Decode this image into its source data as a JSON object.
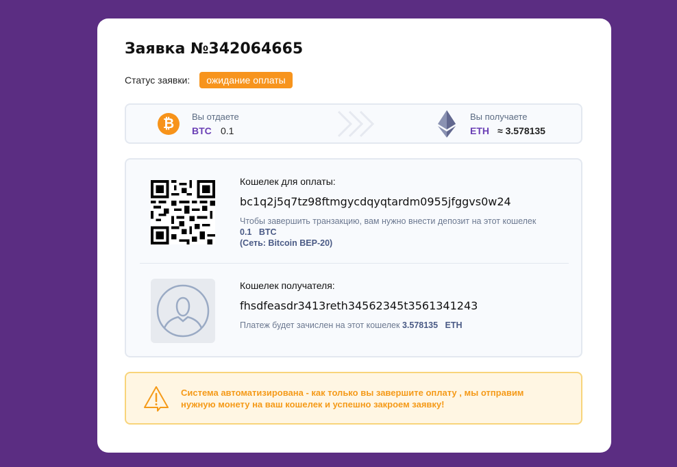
{
  "order": {
    "title": "Заявка №342064665",
    "status_label": "Статус заявки:",
    "status_value": "ожидание оплаты"
  },
  "exchange": {
    "give_label": "Вы отдаете",
    "give_code": "BTC",
    "give_amount": "0.1",
    "get_label": "Вы получаете",
    "get_code": "ETH",
    "get_amount": "≈ 3.578135",
    "give_icon": "bitcoin-icon",
    "get_icon": "ethereum-icon"
  },
  "payment_wallet": {
    "label": "Кошелек для оплаты:",
    "address": "bc1q2j5q7tz98ftmgycdqyqtardm0955jfggvs0w24",
    "note_prefix": "Чтобы завершить транзакцию, вам нужно внести депозит на этот кошелек",
    "note_amount": "0.1",
    "note_code": "BTC",
    "network": "(Сеть: Bitcoin BEP-20)"
  },
  "receiver_wallet": {
    "label": "Кошелек получателя:",
    "address": "fhsdfeasdr3413reth34562345t3561341243",
    "note_prefix": "Платеж будет зачислен на этот кошелек",
    "note_amount": "3.578135",
    "note_code": "ETH"
  },
  "notice": {
    "text": "Система автоматизирована - как только вы завершите оплату , мы отправим нужную монету на ваш кошелек и успешно закроем заявку!"
  },
  "colors": {
    "background": "#5b2d82",
    "accent_orange": "#f7941d",
    "coin_code": "#6a3fb5"
  }
}
